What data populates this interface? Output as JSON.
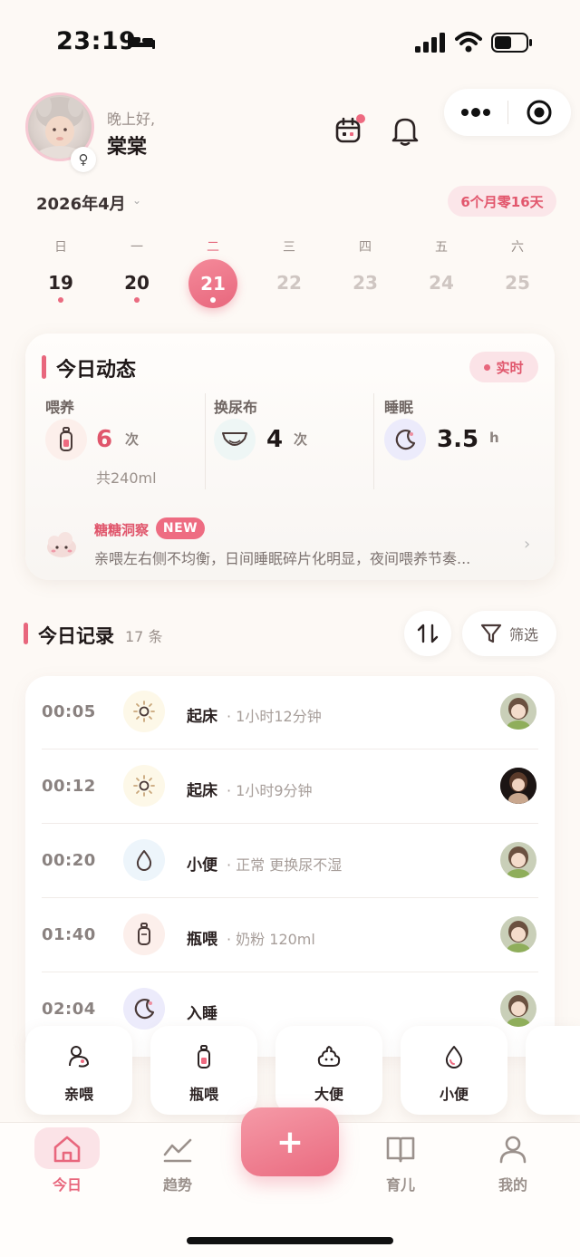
{
  "status_bar": {
    "time": "23:19"
  },
  "header": {
    "greeting": "晚上好,",
    "baby_name": "棠棠",
    "gender_symbol": "♀"
  },
  "calendar": {
    "month": "2026年4月",
    "age": "6个月零16天",
    "weekdays": [
      "日",
      "一",
      "二",
      "三",
      "四",
      "五",
      "六"
    ],
    "days": [
      "19",
      "20",
      "21",
      "22",
      "23",
      "24",
      "25"
    ],
    "selected_day": "21"
  },
  "today_card": {
    "title": "今日动态",
    "live_label": "实时",
    "feeding": {
      "label": "喂养",
      "count": "6",
      "unit": "次",
      "total": "共240ml"
    },
    "diaper": {
      "label": "换尿布",
      "count": "4",
      "unit": "次"
    },
    "sleep": {
      "label": "睡眠",
      "value": "3.5",
      "unit": "h"
    },
    "insight": {
      "title": "糖糖洞察",
      "badge": "NEW",
      "text": "亲喂左右侧不均衡，日间睡眠碎片化明显，夜间喂养节奏..."
    }
  },
  "records": {
    "title": "今日记录",
    "count": "17 条",
    "filter_label": "筛选",
    "items": [
      {
        "time": "00:05",
        "title": "起床",
        "detail": "· 1小时12分钟",
        "icon": "sun-icon"
      },
      {
        "time": "00:12",
        "title": "起床",
        "detail": "· 1小时9分钟",
        "icon": "sun-icon"
      },
      {
        "time": "00:20",
        "title": "小便",
        "detail": "· 正常 更换尿不湿",
        "icon": "drop-icon"
      },
      {
        "time": "01:40",
        "title": "瓶喂",
        "detail": "· 奶粉 120ml",
        "icon": "bottle-icon"
      },
      {
        "time": "02:04",
        "title": "入睡",
        "detail": "",
        "icon": "moon-icon"
      }
    ]
  },
  "quick_actions": [
    {
      "label": "亲喂",
      "icon": "breastfeed-icon"
    },
    {
      "label": "瓶喂",
      "icon": "bottle-icon"
    },
    {
      "label": "大便",
      "icon": "poop-icon"
    },
    {
      "label": "小便",
      "icon": "drop-icon"
    }
  ],
  "tabbar": {
    "items": [
      {
        "label": "今日",
        "icon": "home-icon"
      },
      {
        "label": "趋势",
        "icon": "trend-icon"
      },
      {
        "label": "育儿",
        "icon": "book-icon"
      },
      {
        "label": "我的",
        "icon": "user-icon"
      }
    ],
    "fab_label": "+"
  },
  "colors": {
    "accent": "#e8677d",
    "accent_light": "#fbe3e7",
    "background": "#fdf9f5"
  }
}
